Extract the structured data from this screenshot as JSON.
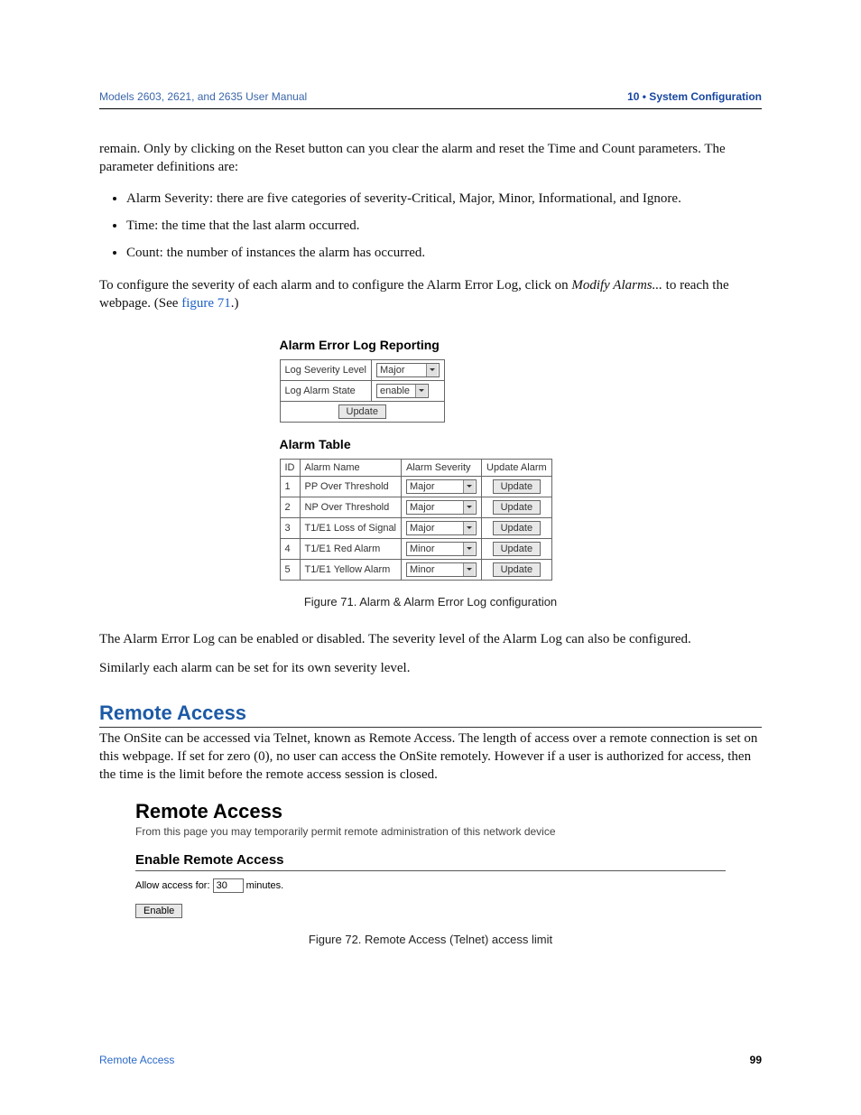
{
  "header": {
    "left": "Models 2603, 2621, and 2635 User Manual",
    "right": "10 • System Configuration"
  },
  "intro_para": "remain. Only by clicking on the Reset button can you clear the alarm and reset the Time and Count parameters. The parameter definitions are:",
  "bullets": [
    "Alarm Severity: there are five categories of severity-Critical, Major, Minor, Informational, and Ignore.",
    "Time: the time that the last alarm occurred.",
    "Count: the number of instances the alarm has occurred."
  ],
  "config_para": {
    "pre": "To configure the severity of each alarm and to configure the Alarm Error Log, click on ",
    "em": "Modify Alarms...",
    "mid": " to reach the webpage. (See ",
    "link": "figure 71",
    "post": ".)"
  },
  "fig71": {
    "title1": "Alarm Error Log Reporting",
    "rows_top": [
      {
        "label": "Log Severity Level",
        "value": "Major"
      },
      {
        "label": "Log Alarm State",
        "value": "enable"
      }
    ],
    "update_btn": "Update",
    "title2": "Alarm Table",
    "headers": [
      "ID",
      "Alarm Name",
      "Alarm Severity",
      "Update Alarm"
    ],
    "rows": [
      {
        "id": "1",
        "name": "PP Over Threshold",
        "sev": "Major",
        "btn": "Update"
      },
      {
        "id": "2",
        "name": "NP Over Threshold",
        "sev": "Major",
        "btn": "Update"
      },
      {
        "id": "3",
        "name": "T1/E1 Loss of Signal",
        "sev": "Major",
        "btn": "Update"
      },
      {
        "id": "4",
        "name": "T1/E1 Red Alarm",
        "sev": "Minor",
        "btn": "Update"
      },
      {
        "id": "5",
        "name": "T1/E1 Yellow Alarm",
        "sev": "Minor",
        "btn": "Update"
      }
    ],
    "caption": "Figure 71. Alarm & Alarm Error Log configuration"
  },
  "para_after_fig71a": "The Alarm Error Log can be enabled or disabled. The severity level of the Alarm Log can also be configured.",
  "para_after_fig71b": "Similarly each alarm can be set for its own severity level.",
  "remote_access": {
    "heading": "Remote Access",
    "para": "The OnSite can be accessed via Telnet, known as Remote Access. The length of access over a remote connection is set on this webpage. If set for zero (0), no user can access the OnSite remotely. However if a user is authorized for access, then the time is the limit before the remote access session is closed."
  },
  "fig72": {
    "title": "Remote Access",
    "sub": "From this page you may temporarily permit remote administration of this network device",
    "enable_head": "Enable Remote Access",
    "row_pre": "Allow access for:",
    "row_val": "30",
    "row_post": "minutes.",
    "btn": "Enable",
    "caption": "Figure 72. Remote Access (Telnet) access limit"
  },
  "footer": {
    "left": "Remote Access",
    "right": "99"
  }
}
